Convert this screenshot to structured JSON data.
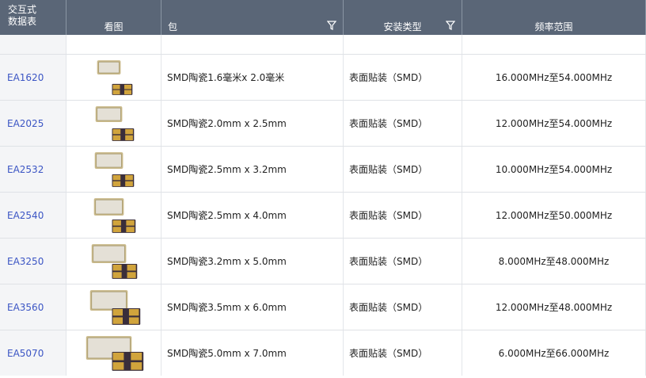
{
  "headers": {
    "datasheet": "交互式\n数据表",
    "image": "看图",
    "package": "包",
    "mount_type": "安装类型",
    "frequency": "频率范围"
  },
  "rows": [
    {
      "part": "EA1620",
      "package": "SMD陶瓷1.6毫米x 2.0毫米",
      "mount": "表面贴装（SMD）",
      "freq": "16.000MHz至54.000MHz"
    },
    {
      "part": "EA2025",
      "package": "SMD陶瓷2.0mm x 2.5mm",
      "mount": "表面贴装（SMD）",
      "freq": "12.000MHz至54.000MHz"
    },
    {
      "part": "EA2532",
      "package": "SMD陶瓷2.5mm x 3.2mm",
      "mount": "表面贴装（SMD）",
      "freq": "10.000MHz至54.000MHz"
    },
    {
      "part": "EA2540",
      "package": "SMD陶瓷2.5mm x 4.0mm",
      "mount": "表面贴装（SMD）",
      "freq": "12.000MHz至50.000MHz"
    },
    {
      "part": "EA3250",
      "package": "SMD陶瓷3.2mm x 5.0mm",
      "mount": "表面贴装（SMD）",
      "freq": "8.000MHz至48.000MHz"
    },
    {
      "part": "EA3560",
      "package": "SMD陶瓷3.5mm x 6.0mm",
      "mount": "表面贴装（SMD）",
      "freq": "12.000MHz至48.000MHz"
    },
    {
      "part": "EA5070",
      "package": "SMD陶瓷5.0mm x 7.0mm",
      "mount": "表面贴装（SMD）",
      "freq": "6.000MHz至66.000MHz"
    }
  ],
  "colors": {
    "header_bg": "#5a6677",
    "link": "#3b55c4"
  }
}
